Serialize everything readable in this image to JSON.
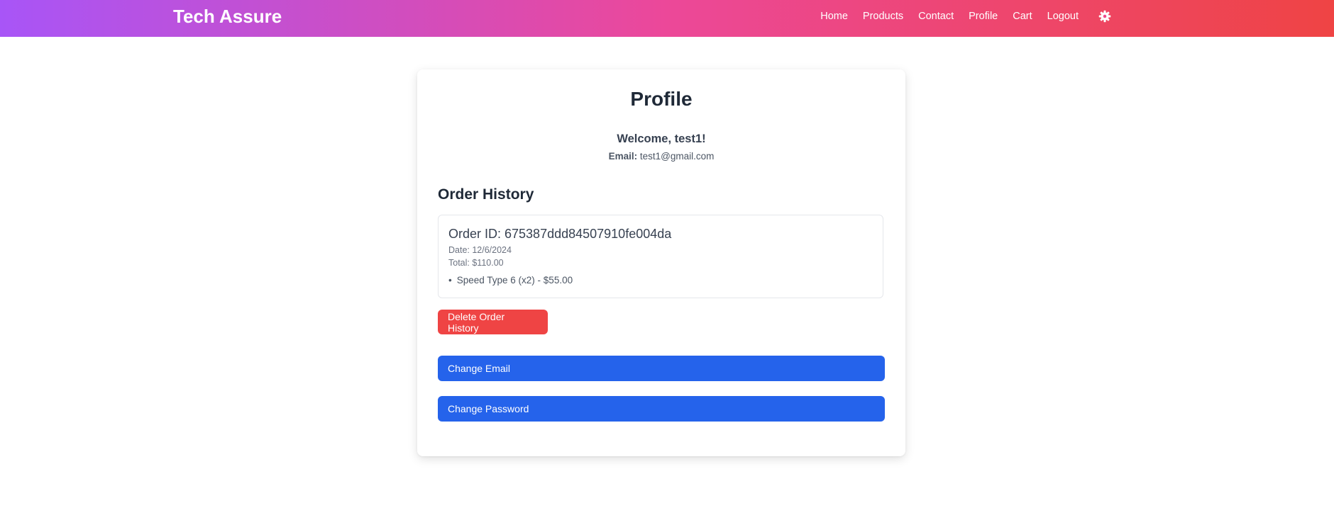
{
  "navbar": {
    "brand": "Tech Assure",
    "links": [
      "Home",
      "Products",
      "Contact",
      "Profile",
      "Cart",
      "Logout"
    ],
    "settings_icon": "gear-icon"
  },
  "profile": {
    "title": "Profile",
    "welcome": "Welcome, test1!",
    "email_label": "Email:",
    "email_value": "test1@gmail.com"
  },
  "order_history": {
    "title": "Order History",
    "orders": [
      {
        "id_text": "Order ID: 675387ddd84507910fe004da",
        "date_text": "Date: 12/6/2024",
        "total_text": "Total: $110.00",
        "items": [
          "Speed Type 6 (x2) - $55.00"
        ]
      }
    ],
    "delete_label": "Delete Order History"
  },
  "account_actions": {
    "change_email_label": "Change Email",
    "change_password_label": "Change Password"
  },
  "colors": {
    "nav_gradient": [
      "#a855f7",
      "#ec4899",
      "#ef4444"
    ],
    "danger": "#ef4444",
    "primary": "#2563eb"
  }
}
